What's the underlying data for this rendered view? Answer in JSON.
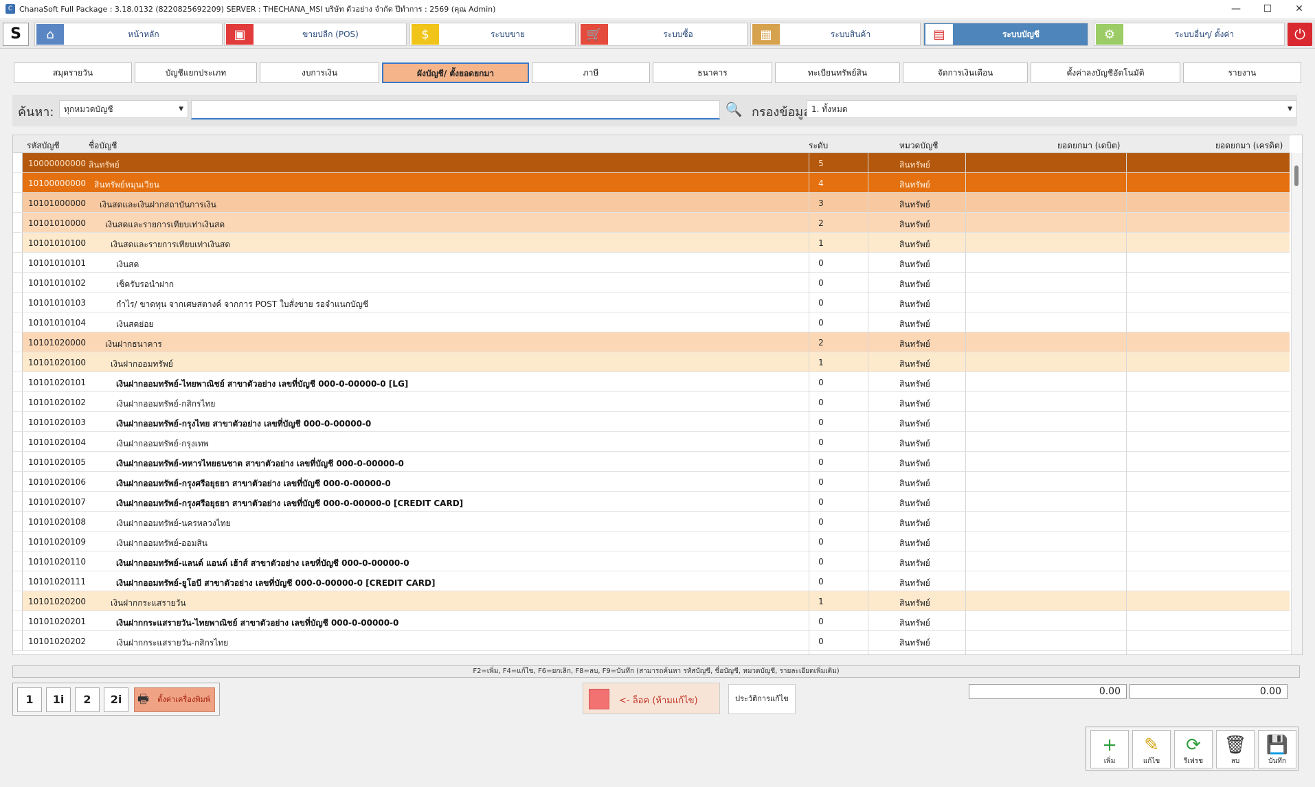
{
  "window": {
    "title": "ChanaSoft Full Package : 3.18.0132 (8220825692209) SERVER : THECHANA_MSI บริษัท ตัวอย่าง จำกัด ปีทำการ : 2569 (คุณ Admin)",
    "minimize": "—",
    "maximize": "☐",
    "close": "✕"
  },
  "menubar": {
    "logo": "S",
    "items": [
      {
        "label": "หน้าหลัก",
        "icon": "home-icon",
        "color": "#5b86c4",
        "glyph": "⌂"
      },
      {
        "label": "ขายปลีก (POS)",
        "icon": "pos-terminal-icon",
        "color": "#e23b3b",
        "glyph": "▣"
      },
      {
        "label": "ระบบขาย",
        "icon": "coin-icon",
        "color": "#f0c419",
        "glyph": "$"
      },
      {
        "label": "ระบบซื้อ",
        "icon": "cart-icon",
        "color": "#e44b3c",
        "glyph": "🛒"
      },
      {
        "label": "ระบบสินค้า",
        "icon": "box-icon",
        "color": "#d7a24e",
        "glyph": "▦"
      },
      {
        "label": "ระบบบัญชี",
        "icon": "ledger-icon",
        "color": "#ffffff",
        "glyph": "▤"
      },
      {
        "label": "ระบบอื่นๆ/ ตั้งค่า",
        "icon": "gear-icon",
        "color": "#9ccc65",
        "glyph": "⚙"
      }
    ],
    "power": "⏻"
  },
  "tabs": [
    "สมุดรายวัน",
    "บัญชีแยกประเภท",
    "งบการเงิน",
    "ผังบัญชี/ ตั้งยอดยกมา",
    "ภาษี",
    "ธนาคาร",
    "ทะเบียนทรัพย์สิน",
    "จัดการเงินเดือน",
    "ตั้งค่าลงบัญชีอัตโนมัติ",
    "รายงาน"
  ],
  "search": {
    "label": "ค้นหา:",
    "category_value": "ทุกหมวดบัญชี",
    "input_value": "",
    "filter_label": "กรองข้อมูล:",
    "filter_value": "1. ทั้งหมด"
  },
  "grid": {
    "headers": {
      "code": "รหัสบัญชี",
      "name": "ชื่อบัญชี",
      "level": "ระดับ",
      "category": "หมวดบัญชี",
      "debit": "ยอดยกมา (เดบิต)",
      "credit": "ยอดยกมา (เครดิต)"
    },
    "rows": [
      {
        "code": "10000000000",
        "name": "สินทรัพย์",
        "level": "5",
        "category": "สินทรัพย์",
        "indent": 0,
        "style": "l5",
        "bold": false
      },
      {
        "code": "10100000000",
        "name": "สินทรัพย์หมุนเวียน",
        "level": "4",
        "category": "สินทรัพย์",
        "indent": 1,
        "style": "l4",
        "bold": false
      },
      {
        "code": "10101000000",
        "name": "เงินสดและเงินฝากสถาบันการเงิน",
        "level": "3",
        "category": "สินทรัพย์",
        "indent": 2,
        "style": "l3",
        "bold": false
      },
      {
        "code": "10101010000",
        "name": "เงินสดและรายการเทียบเท่าเงินสด",
        "level": "2",
        "category": "สินทรัพย์",
        "indent": 3,
        "style": "l2",
        "bold": false
      },
      {
        "code": "10101010100",
        "name": "เงินสดและรายการเทียบเท่าเงินสด",
        "level": "1",
        "category": "สินทรัพย์",
        "indent": 4,
        "style": "l1",
        "bold": false
      },
      {
        "code": "10101010101",
        "name": "เงินสด",
        "level": "0",
        "category": "สินทรัพย์",
        "indent": 5,
        "style": "",
        "bold": false
      },
      {
        "code": "10101010102",
        "name": "เช็ครับรอนำฝาก",
        "level": "0",
        "category": "สินทรัพย์",
        "indent": 5,
        "style": "",
        "bold": false
      },
      {
        "code": "10101010103",
        "name": "กำไร/ ขาดทุน จากเศษสตางค์ จากการ POST ใบสั่งขาย รอจำแนกบัญชี",
        "level": "0",
        "category": "สินทรัพย์",
        "indent": 5,
        "style": "",
        "bold": false
      },
      {
        "code": "10101010104",
        "name": "เงินสดย่อย",
        "level": "0",
        "category": "สินทรัพย์",
        "indent": 5,
        "style": "",
        "bold": false
      },
      {
        "code": "10101020000",
        "name": "เงินฝากธนาคาร",
        "level": "2",
        "category": "สินทรัพย์",
        "indent": 3,
        "style": "l2",
        "bold": false
      },
      {
        "code": "10101020100",
        "name": "เงินฝากออมทรัพย์",
        "level": "1",
        "category": "สินทรัพย์",
        "indent": 4,
        "style": "l1",
        "bold": false
      },
      {
        "code": "10101020101",
        "name": "เงินฝากออมทรัพย์-ไทยพาณิชย์ สาขาตัวอย่าง เลขที่บัญชี 000-0-00000-0 [LG]",
        "level": "0",
        "category": "สินทรัพย์",
        "indent": 5,
        "style": "",
        "bold": true
      },
      {
        "code": "10101020102",
        "name": "เงินฝากออมทรัพย์-กสิกรไทย",
        "level": "0",
        "category": "สินทรัพย์",
        "indent": 5,
        "style": "",
        "bold": false
      },
      {
        "code": "10101020103",
        "name": "เงินฝากออมทรัพย์-กรุงไทย สาขาตัวอย่าง เลขที่บัญชี 000-0-00000-0",
        "level": "0",
        "category": "สินทรัพย์",
        "indent": 5,
        "style": "",
        "bold": true
      },
      {
        "code": "10101020104",
        "name": "เงินฝากออมทรัพย์-กรุงเทพ",
        "level": "0",
        "category": "สินทรัพย์",
        "indent": 5,
        "style": "",
        "bold": false
      },
      {
        "code": "10101020105",
        "name": "เงินฝากออมทรัพย์-ทหารไทยธนชาต สาขาตัวอย่าง เลขที่บัญชี 000-0-00000-0",
        "level": "0",
        "category": "สินทรัพย์",
        "indent": 5,
        "style": "",
        "bold": true
      },
      {
        "code": "10101020106",
        "name": "เงินฝากออมทรัพย์-กรุงศรีอยุธยา สาขาตัวอย่าง เลขที่บัญชี 000-0-00000-0",
        "level": "0",
        "category": "สินทรัพย์",
        "indent": 5,
        "style": "",
        "bold": true
      },
      {
        "code": "10101020107",
        "name": "เงินฝากออมทรัพย์-กรุงศรีอยุธยา สาขาตัวอย่าง เลขที่บัญชี 000-0-00000-0 [CREDIT CARD]",
        "level": "0",
        "category": "สินทรัพย์",
        "indent": 5,
        "style": "",
        "bold": true
      },
      {
        "code": "10101020108",
        "name": "เงินฝากออมทรัพย์-นครหลวงไทย",
        "level": "0",
        "category": "สินทรัพย์",
        "indent": 5,
        "style": "",
        "bold": false
      },
      {
        "code": "10101020109",
        "name": "เงินฝากออมทรัพย์-ออมสิน",
        "level": "0",
        "category": "สินทรัพย์",
        "indent": 5,
        "style": "",
        "bold": false
      },
      {
        "code": "10101020110",
        "name": "เงินฝากออมทรัพย์-แลนด์ แอนด์ เฮ้าส์ สาขาตัวอย่าง เลขที่บัญชี 000-0-00000-0",
        "level": "0",
        "category": "สินทรัพย์",
        "indent": 5,
        "style": "",
        "bold": true
      },
      {
        "code": "10101020111",
        "name": "เงินฝากออมทรัพย์-ยูโอบี สาขาตัวอย่าง เลขที่บัญชี 000-0-00000-0 [CREDIT CARD]",
        "level": "0",
        "category": "สินทรัพย์",
        "indent": 5,
        "style": "",
        "bold": true
      },
      {
        "code": "10101020200",
        "name": "เงินฝากกระแสรายวัน",
        "level": "1",
        "category": "สินทรัพย์",
        "indent": 4,
        "style": "l1",
        "bold": false
      },
      {
        "code": "10101020201",
        "name": "เงินฝากกระแสรายวัน-ไทยพาณิชย์ สาขาตัวอย่าง เลขที่บัญชี 000-0-00000-0",
        "level": "0",
        "category": "สินทรัพย์",
        "indent": 5,
        "style": "",
        "bold": true
      },
      {
        "code": "10101020202",
        "name": "เงินฝากกระแสรายวัน-กสิกรไทย",
        "level": "0",
        "category": "สินทรัพย์",
        "indent": 5,
        "style": "",
        "bold": false
      }
    ]
  },
  "hint": "F2=เพิ่ม,   F4=แก้ไข,   F6=ยกเลิก,   F8=ลบ,   F9=บันทึก   (สามารถค้นหา รหัสบัญชี, ชื่อบัญชี, หมวดบัญชี, รายละเอียดเพิ่มเติม)",
  "print": {
    "buttons": [
      "1",
      "1i",
      "2",
      "2i"
    ],
    "settings_label": "ตั้งค่าเครื่องพิมพ์"
  },
  "lock": {
    "label": "<- ล็อค (ห้ามแก้ไข)",
    "color": "#f27272"
  },
  "history_label": "ประวัติการแก้ไข",
  "totals": {
    "debit": "0.00",
    "credit": "0.00"
  },
  "actions": [
    {
      "label": "เพิ่ม",
      "icon": "add-document-icon",
      "glyph": "+",
      "color": "#2e9e3e"
    },
    {
      "label": "แก้ไข",
      "icon": "edit-document-icon",
      "glyph": "✎",
      "color": "#d4a20f"
    },
    {
      "label": "รีเฟรช",
      "icon": "refresh-icon",
      "glyph": "⟳",
      "color": "#2e9e3e"
    },
    {
      "label": "ลบ",
      "icon": "trash-icon",
      "glyph": "🗑",
      "color": "#333333"
    },
    {
      "label": "บันทึก",
      "icon": "save-icon",
      "glyph": "💾",
      "color": "#2a6fb8"
    }
  ]
}
